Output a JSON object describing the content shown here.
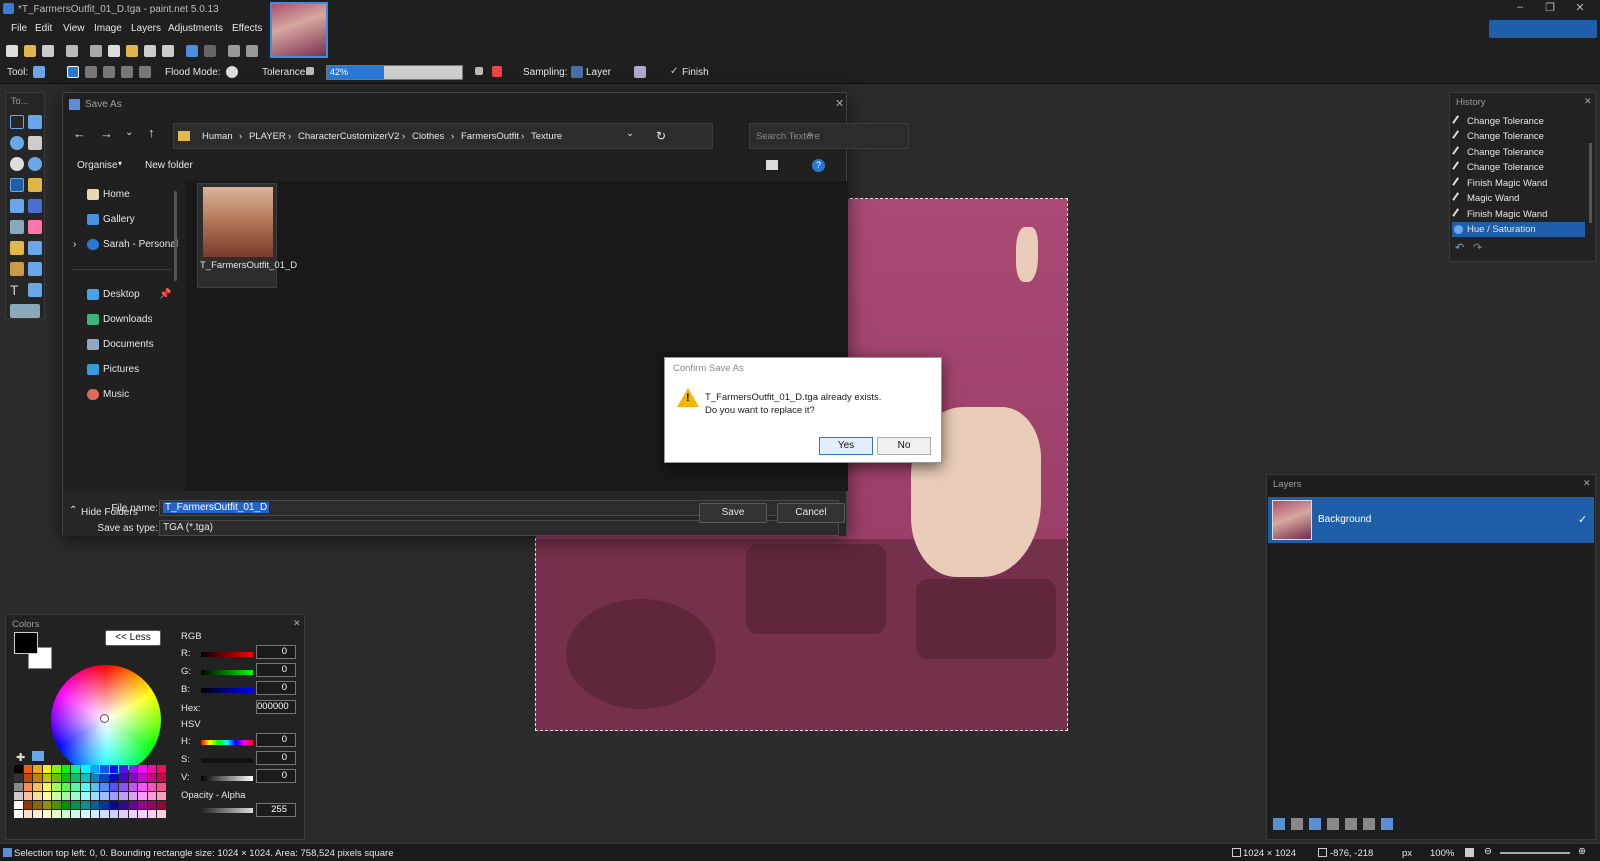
{
  "window": {
    "title": "*T_FarmersOutfit_01_D.tga - paint.net 5.0.13"
  },
  "menu": [
    "File",
    "Edit",
    "View",
    "Image",
    "Layers",
    "Adjustments",
    "Effects"
  ],
  "toolbar": {
    "tool_label": "Tool:",
    "flood_mode_label": "Flood Mode:",
    "tolerance_label": "Tolerance:",
    "tolerance_value": "42%",
    "tolerance_fraction": 0.42,
    "sampling_label": "Sampling:",
    "sampling_value": "Layer",
    "finish_label": "Finish"
  },
  "tools_panel": {
    "title": "To..."
  },
  "save_as": {
    "title": "Save As",
    "breadcrumb": [
      "Human",
      "PLAYER",
      "CharacterCustomizerV2",
      "Clothes",
      "FarmersOutfit",
      "Texture"
    ],
    "search_placeholder": "Search Texture",
    "organise_label": "Organise",
    "new_folder_label": "New folder",
    "nav": {
      "top": [
        "Home",
        "Gallery",
        "Sarah - Personal"
      ],
      "pinned": [
        "Desktop",
        "Downloads",
        "Documents",
        "Pictures",
        "Music"
      ]
    },
    "file_item": "T_FarmersOutfit_01_D",
    "file_name_label": "File name:",
    "file_name_value": "T_FarmersOutfit_01_D",
    "save_type_label": "Save as type:",
    "save_type_value": "TGA (*.tga)",
    "hide_folders_label": "Hide Folders",
    "save_button": "Save",
    "cancel_button": "Cancel"
  },
  "confirm": {
    "title": "Confirm Save As",
    "message_line1": "T_FarmersOutfit_01_D.tga already exists.",
    "message_line2": "Do you want to replace it?",
    "yes": "Yes",
    "no": "No"
  },
  "history": {
    "title": "History",
    "items": [
      "Change Tolerance",
      "Change Tolerance",
      "Change Tolerance",
      "Change Tolerance",
      "Finish Magic Wand",
      "Magic Wand",
      "Finish Magic Wand",
      "Hue / Saturation"
    ],
    "selected_index": 7
  },
  "layers": {
    "title": "Layers",
    "items": [
      "Background"
    ]
  },
  "colors": {
    "title": "Colors",
    "less_button": "<< Less",
    "rgb_label": "RGB",
    "hsv_label": "HSV",
    "r_label": "R:",
    "g_label": "G:",
    "b_label": "B:",
    "hex_label": "Hex:",
    "h_label": "H:",
    "s_label": "S:",
    "v_label": "V:",
    "r": "0",
    "g": "0",
    "b": "0",
    "hex": "000000",
    "h": "0",
    "s": "0",
    "v": "0",
    "opacity_label": "Opacity - Alpha",
    "alpha": "255"
  },
  "status": {
    "selection_info": "Selection top left: 0, 0. Bounding rectangle size: 1024 × 1024. Area: 758,524 pixels square",
    "image_size": "1024 × 1024",
    "cursor_pos": "-876, -218",
    "units": "px",
    "zoom": "100%"
  },
  "colors_theme": {
    "accent": "#1f5faa",
    "canvas_pink": "#a84a74"
  }
}
